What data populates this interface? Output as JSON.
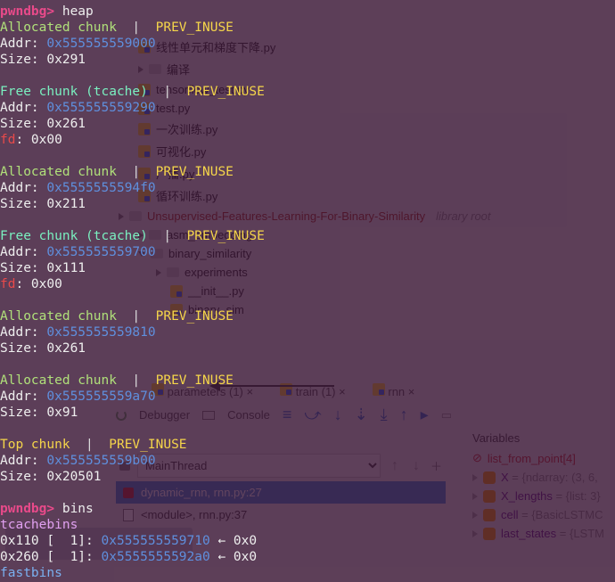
{
  "tree": {
    "items": [
      {
        "type": "py",
        "label": "线性单元和梯度下降.py"
      },
      {
        "type": "folder",
        "label": "编译"
      },
      {
        "type": "py",
        "label": "tensorflow_test.py"
      },
      {
        "type": "py",
        "label": "test.py"
      },
      {
        "type": "py",
        "label": "一次训练.py"
      },
      {
        "type": "py",
        "label": "可视化.py"
      },
      {
        "type": "py",
        "label": "广播.py"
      },
      {
        "type": "py",
        "label": "循环训练.py"
      },
      {
        "type": "libroot",
        "label": "Unsupervised-Features-Learning-For-Binary-Similarity",
        "suffix": "library root"
      },
      {
        "type": "folder",
        "label": "asm_embedding",
        "indent": 1
      },
      {
        "type": "folder",
        "label": "binary_similarity",
        "indent": 1
      },
      {
        "type": "folder",
        "label": "experiments",
        "indent": 2
      },
      {
        "type": "py",
        "label": "__init__.py",
        "indent": 2
      },
      {
        "type": "py",
        "label": "binary_sim",
        "indent": 2
      }
    ]
  },
  "editorTabs": {
    "t1": "parameters (1)",
    "t2": "train (1)",
    "t3": "rnn"
  },
  "debugger": {
    "tab1": "Debugger",
    "tab2": "Console"
  },
  "threads": {
    "main": "MainThread",
    "f1": "dynamic_rnn, rnn.py:27",
    "f2": "<module>, rnn.py:37"
  },
  "vars": {
    "title": "Variables",
    "r1": {
      "n": "list_from_point[4]"
    },
    "r2": {
      "n": "X",
      "v": " = {ndarray: (3, 6, "
    },
    "r3": {
      "n": "X_lengths",
      "v": " = {list: 3}"
    },
    "r4": {
      "n": "cell",
      "v": " = {BasicLSTMC"
    },
    "r5": {
      "n": "last_states",
      "v": " = {LSTM"
    }
  },
  "term": {
    "l1p": "pwndbg>",
    "l1c": " heap",
    "l2a": "Allocated chunk",
    "bar": "  |  ",
    "pu": "PREV_INUSE",
    "a1": "Addr: ",
    "a1v": "0x555555559000",
    "s1": "Size: 0x291",
    "fc": "Free chunk (tcache)",
    "a2v": "0x555555559290",
    "s2": "Size: 0x261",
    "fd": "fd",
    "fdv": ": 0x00",
    "a3v": "0x5555555594f0",
    "s3": "Size: 0x211",
    "a4v": "0x555555559700",
    "s4": "Size: 0x111",
    "a5v": "0x555555559810",
    "s5": "Size: 0x261",
    "a6v": "0x555555559a70",
    "s6": "Size: 0x91",
    "tc": "Top chunk",
    "a7v": "0x555555559b00",
    "s7": "Size: 0x20501",
    "l20c": " bins",
    "tcb": "tcachebins",
    "b1": "0x110 [  1]: ",
    "b1v": "0x555555559710",
    "barr": " ← 0x0",
    "b2": "0x260 [  1]: ",
    "b2v": "0x5555555592a0",
    "fbn": "fastbins"
  }
}
